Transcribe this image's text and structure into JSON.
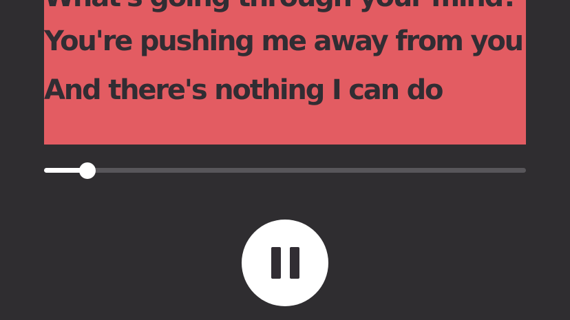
{
  "lyrics": {
    "lines": [
      "What's going through your mind?",
      "You're pushing me away from you",
      "And there's nothing I can do"
    ]
  },
  "player": {
    "progress_fraction": 0.09,
    "is_playing": true,
    "control_icon": "pause-icon"
  },
  "colors": {
    "background": "#2f2d30",
    "lyrics_card": "#e35c62",
    "lyrics_text": "#312d33",
    "track": "#58565a",
    "accent": "#ffffff"
  }
}
